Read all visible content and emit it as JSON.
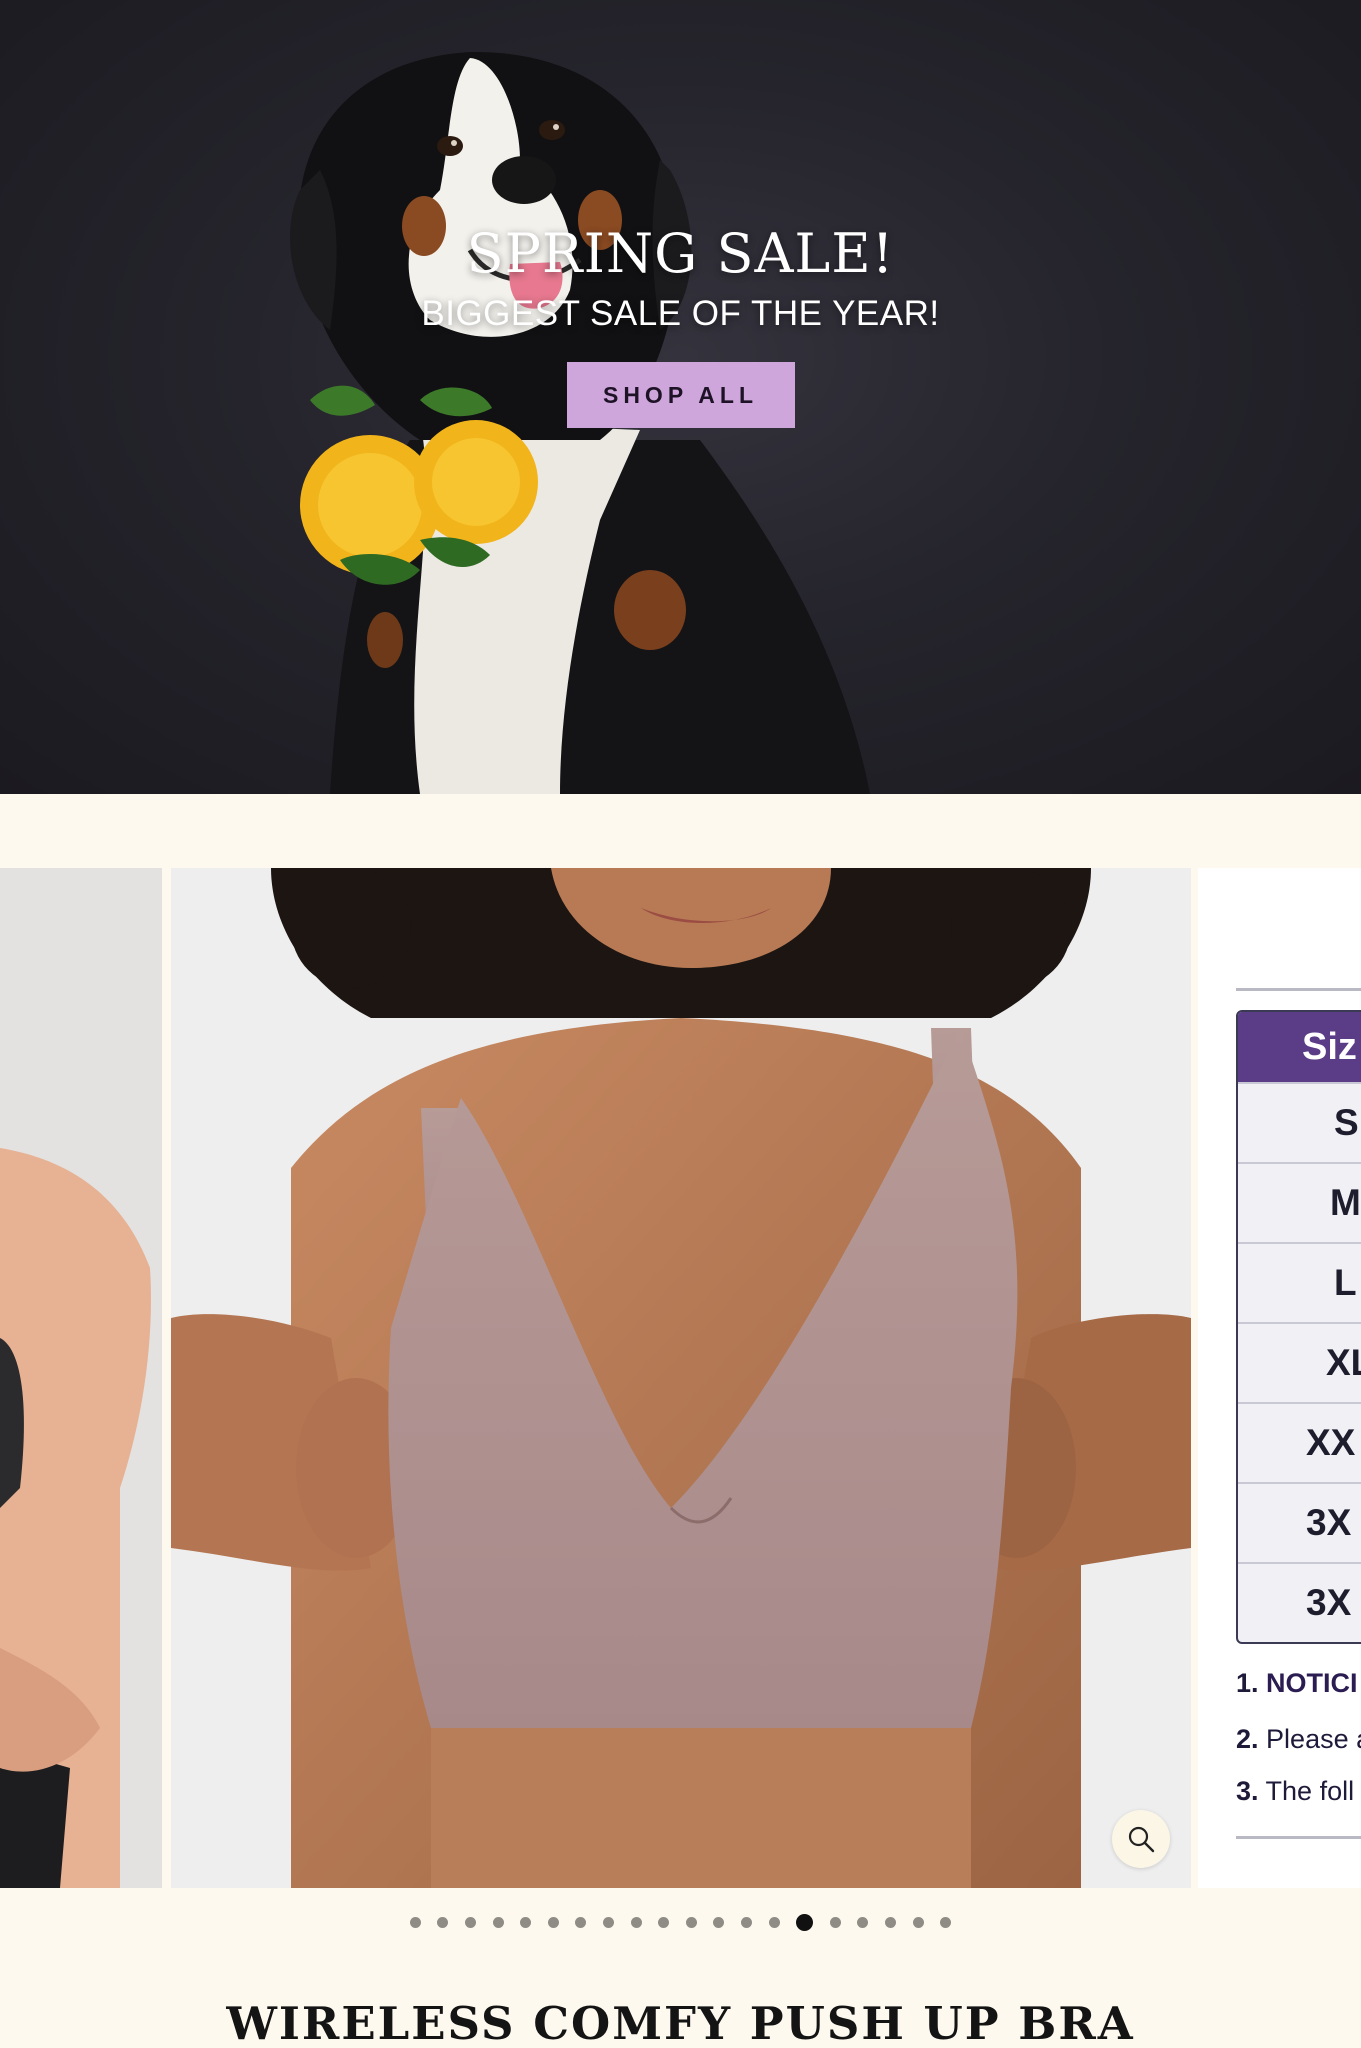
{
  "hero": {
    "title": "SPRING SALE!",
    "subtitle": "BIGGEST SALE OF THE YEAR!",
    "button_label": "SHOP ALL",
    "button_color": "#cfa6dc",
    "background_color": "#24232a"
  },
  "gallery": {
    "slides": [
      {
        "content": "woman-in-black-sports-top-photo"
      },
      {
        "content": "woman-wearing-taupe-wireless-bra-photo"
      },
      {
        "content": "size-chart-image"
      }
    ],
    "zoom_icon": "magnifier-icon",
    "size_chart": {
      "header": "Siz",
      "rows": [
        "S",
        "M",
        "L",
        "XL",
        "XX",
        "3X",
        "3X"
      ],
      "notes": [
        {
          "num": "1.",
          "text": "NOTICI"
        },
        {
          "num": "2.",
          "text": "Please a"
        },
        {
          "num": "3.",
          "text": "The foll"
        }
      ],
      "header_color": "#5b3c86"
    }
  },
  "carousel": {
    "count": 20,
    "active_index": 14
  },
  "product": {
    "title": "WIRELESS COMFY PUSH UP BRA"
  }
}
